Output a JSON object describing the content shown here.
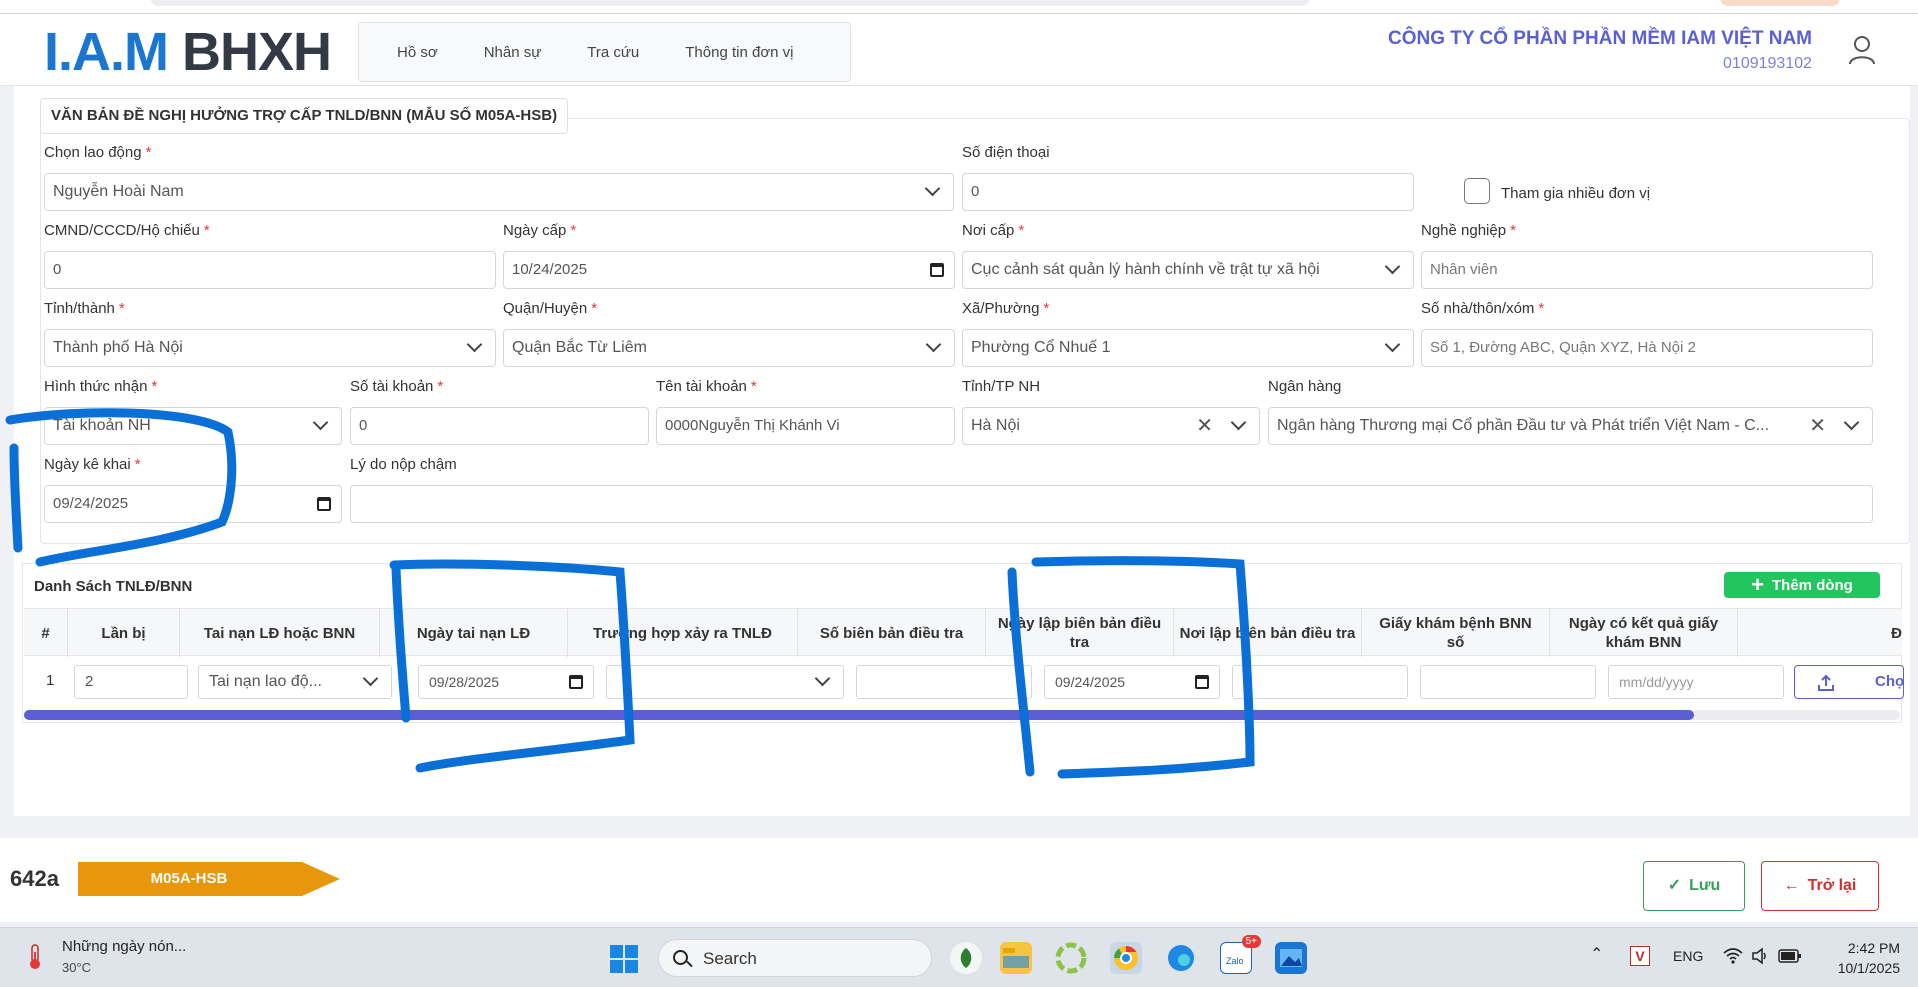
{
  "header": {
    "logo_iam": "I.A.M",
    "logo_bhxh": "BHXH",
    "nav": [
      "Hồ sơ",
      "Nhân sự",
      "Tra cứu",
      "Thông tin đơn vị"
    ],
    "company_name": "CÔNG TY CỔ PHẦN PHẦN MỀM IAM VIỆT NAM",
    "company_code": "0109193102",
    "user_icon": "user-icon"
  },
  "form": {
    "legend": "VĂN BẢN ĐỀ NGHỊ HƯỞNG TRỢ CẤP TNLD/BNN (MẪU SỐ M05A-HSB)",
    "required_mark": "*",
    "worker_label": "Chọn lao động",
    "worker_value": "Nguyễn Hoài Nam",
    "phone_label": "Số điện thoại",
    "phone_value": "0",
    "multi_unit_label": "Tham gia nhiều đơn vị",
    "multi_unit_checked": false,
    "id_label": "CMND/CCCD/Hộ chiếu",
    "id_value": "0",
    "issue_date_label": "Ngày cấp",
    "issue_date_value": "10/24/2025",
    "issue_place_label": "Nơi cấp",
    "issue_place_value": "Cục cảnh sát quản lý hành chính về trật tự xã hội",
    "occupation_label": "Nghề nghiệp",
    "occupation_placeholder": "Nhân viên",
    "province_label": "Tỉnh/thành",
    "province_value": "Thành phố Hà Nội",
    "district_label": "Quận/Huyện",
    "district_value": "Quận Bắc Từ Liêm",
    "ward_label": "Xã/Phường",
    "ward_value": "Phường Cổ Nhuế 1",
    "address_label": "Số nhà/thôn/xóm",
    "address_placeholder": "Số 1, Đường ABC, Quận XYZ, Hà Nội 2",
    "receive_method_label": "Hình thức nhận",
    "receive_method_value": "Tài khoản NH",
    "account_no_label": "Số tài khoản",
    "account_no_value": "0",
    "account_name_label": "Tên tài khoản",
    "account_name_value": "0000Nguyễn Thị Khánh Vi",
    "bank_province_label": "Tỉnh/TP NH",
    "bank_province_value": "Hà Nội",
    "bank_label": "Ngân hàng",
    "bank_value": "Ngân hàng Thương mại Cổ phần Đầu tư và Phát triển Việt Nam - C...",
    "declare_date_label": "Ngày kê khai",
    "declare_date_value": "09/24/2025",
    "late_reason_label": "Lý do nộp chậm",
    "late_reason_value": ""
  },
  "table": {
    "title": "Danh Sách TNLĐ/BNN",
    "add_button": "Thêm dòng",
    "columns": [
      "#",
      "Lần bị",
      "Tai nạn LĐ hoặc BNN",
      "Ngày tai nạn LĐ",
      "Trường hợp xảy ra TNLĐ",
      "Số biên bản điều tra",
      "Ngày lập biên bản điều tra",
      "Nơi lập biên bản điều tra",
      "Giấy khám bệnh BNN số",
      "Ngày có kết quả giấy khám BNN",
      "Đ"
    ],
    "rows": [
      {
        "num": "1",
        "times": "2",
        "type": "Tai nạn lao độ...",
        "accident_date": "09/28/2025",
        "case": "",
        "report_no": "",
        "report_date": "09/24/2025",
        "report_place": "",
        "bnn_no": "",
        "bnn_date_placeholder": "mm/dd/yyyy",
        "choose_button": "Chọn"
      }
    ],
    "scroll_position_fraction": 0.89
  },
  "footer": {
    "code": "642a",
    "badge": "M05A-HSB",
    "save_button": "Lưu",
    "back_button": "Trở lại",
    "badge_color": "#e8960c"
  },
  "taskbar": {
    "weather_text": "Những ngày nón...",
    "weather_temp": "30°C",
    "search_text": "Search",
    "zalo_badge": "5+",
    "lang": "ENG",
    "time": "2:42 PM",
    "date": "10/1/2025"
  },
  "colors": {
    "accent": "#5a5fd6",
    "logo_blue": "#1b76d2",
    "add_green": "#22c55e",
    "annotation_blue": "#0b6fd8"
  }
}
